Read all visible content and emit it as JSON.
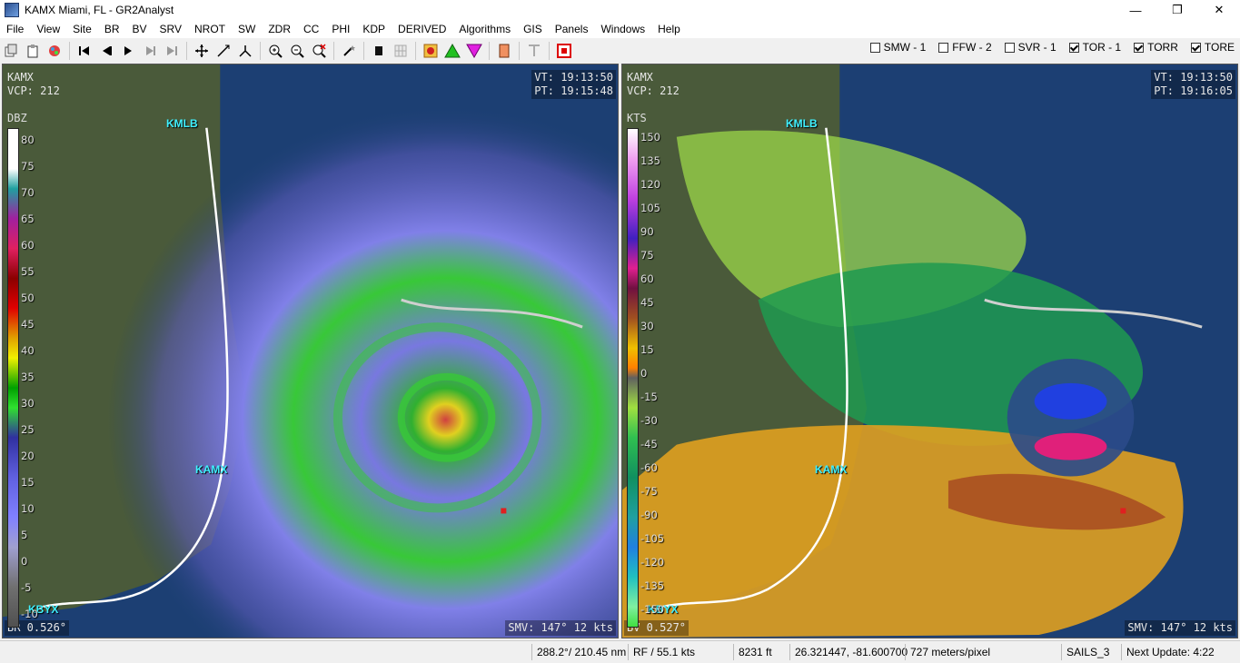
{
  "window": {
    "title": "KAMX Miami, FL - GR2Analyst",
    "minimize": "—",
    "maximize": "❐",
    "close": "✕"
  },
  "menu": [
    "File",
    "View",
    "Site",
    "BR",
    "BV",
    "SRV",
    "NROT",
    "SW",
    "ZDR",
    "CC",
    "PHI",
    "KDP",
    "DERIVED",
    "Algorithms",
    "GIS",
    "Panels",
    "Windows",
    "Help"
  ],
  "toolbar": {
    "icons": [
      "copy-icon",
      "paste-icon",
      "palette-icon",
      "skip-first-icon",
      "step-back-icon",
      "play-icon",
      "step-forward-icon",
      "skip-last-icon",
      "move-icon",
      "measure-icon",
      "cross-section-icon",
      "zoom-in-icon",
      "zoom-out-icon",
      "zoom-reset-icon",
      "wand-icon",
      "storm-track-icon",
      "grid-icon",
      "hurricane-icon",
      "up-triangle-icon",
      "down-triangle-icon",
      "color-table-icon",
      "text-icon",
      "stop-icon"
    ],
    "checks": [
      {
        "label": "SMW - 1",
        "checked": false
      },
      {
        "label": "FFW - 2",
        "checked": false
      },
      {
        "label": "SVR - 1",
        "checked": false
      },
      {
        "label": "TOR - 1",
        "checked": true
      },
      {
        "label": "TORR",
        "checked": true
      },
      {
        "label": "TORE",
        "checked": true
      }
    ]
  },
  "left_pane": {
    "site": "KAMX\nVCP: 212",
    "times": "VT: 19:13:50\nPT: 19:15:48",
    "product": "BR 0.526°",
    "smv": "SMV: 147° 12 kts",
    "unit": "DBZ",
    "scale_ticks": [
      "80",
      "75",
      "70",
      "65",
      "60",
      "55",
      "50",
      "45",
      "40",
      "35",
      "30",
      "25",
      "20",
      "15",
      "10",
      "5",
      "0",
      "-5",
      "-10"
    ],
    "sites": [
      "KMLB",
      "KAMX",
      "KBYX"
    ]
  },
  "right_pane": {
    "site": "KAMX\nVCP: 212",
    "times": "VT: 19:13:50\nPT: 19:16:05",
    "product": "BV 0.527°",
    "smv": "SMV: 147° 12 kts",
    "unit": "KTS",
    "scale_ticks": [
      "150",
      "135",
      "120",
      "105",
      "90",
      "75",
      "60",
      "45",
      "30",
      "15",
      "0",
      "-15",
      "-30",
      "-45",
      "-60",
      "-75",
      "-90",
      "-105",
      "-120",
      "-135",
      "-150"
    ],
    "sites": [
      "KMLB",
      "KAMX",
      "KBYX"
    ]
  },
  "status": {
    "azimuth": "288.2°/ 210.45 nm",
    "rf": "RF / 55.1 kts",
    "height": "8231 ft",
    "latlon": "26.321447, -81.600700",
    "resolution": "727 meters/pixel",
    "sails": "SAILS_3",
    "next_update": "Next Update: 4:22"
  },
  "colors": {
    "ocean": "#1c3f73",
    "land": "#4a5a3a",
    "reflectivity_green": "#38c838",
    "reflectivity_purple": "#8c8cf0",
    "velocity_outbound": "#e0a020",
    "velocity_inbound": "#20a060",
    "site_label": "#3ff0ff"
  }
}
